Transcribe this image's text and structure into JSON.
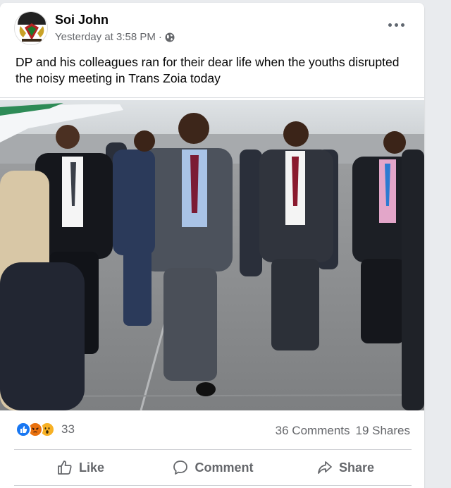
{
  "post": {
    "author": "Soi John",
    "timestamp": "Yesterday at 3:58 PM",
    "separator": "·",
    "privacy_icon": "globe-icon",
    "text": "DP and his colleagues ran for their dear life when the youths disrupted the noisy meeting in Trans Zoia today"
  },
  "stats": {
    "reactions": [
      "like-icon",
      "angry-icon",
      "wow-icon"
    ],
    "reaction_count": "33",
    "comments": "36 Comments",
    "shares": "19 Shares"
  },
  "actions": {
    "like_label": "Like",
    "comment_label": "Comment",
    "share_label": "Share"
  },
  "colors": {
    "brand_blue": "#1877f2",
    "secondary_text": "#65676b",
    "primary_text": "#050505"
  }
}
